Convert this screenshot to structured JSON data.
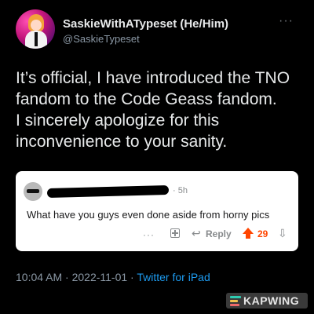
{
  "tweet": {
    "display_name": "SaskieWithATypeset (He/Him)",
    "handle": "@SaskieTypeset",
    "text_lines": [
      "It’s official, I have introduced the TNO",
      "fandom to the Code Geass fandom.",
      "I sincerely apologize for this",
      "inconvenience to your sanity."
    ],
    "timestamp": "10:04 AM · 2022-11-01 · ",
    "source": "Twitter for iPad",
    "more_icon": "more-horizontal-icon"
  },
  "embedded_comment": {
    "age": "· 5h",
    "text": "What have you guys even done aside from horny pics",
    "more_label": "···",
    "reply_label": "Reply",
    "score": "29",
    "upvote_color": "#ff4500"
  },
  "watermark": {
    "text": "KAPWING"
  },
  "colors": {
    "background": "#000000",
    "primary_text": "#e7e9ea",
    "secondary_text": "#8b98a5",
    "link": "#1d9bf0"
  }
}
